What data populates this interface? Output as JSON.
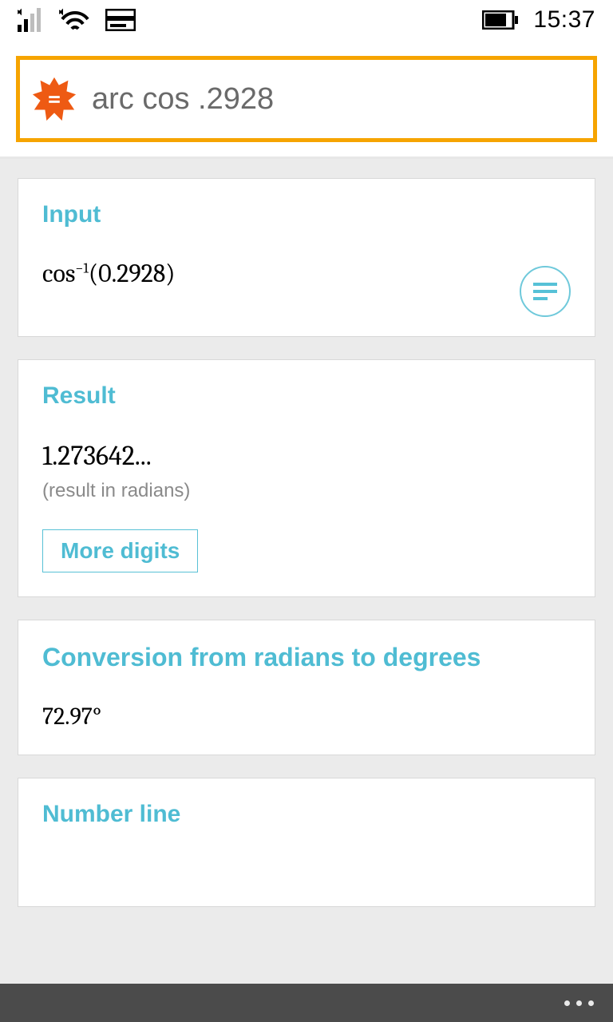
{
  "status": {
    "time": "15:37"
  },
  "search": {
    "query": "arc cos .2928"
  },
  "cards": {
    "input": {
      "title": "Input",
      "formula_prefix": "cos",
      "formula_exp": "−1",
      "formula_arg": "(0.2928)"
    },
    "result": {
      "title": "Result",
      "value": "1.273642...",
      "note": "(result in radians)",
      "more_label": "More digits"
    },
    "conversion": {
      "title": "Conversion from radians to degrees",
      "value": "72.97°"
    },
    "numberline": {
      "title": "Number line"
    }
  }
}
